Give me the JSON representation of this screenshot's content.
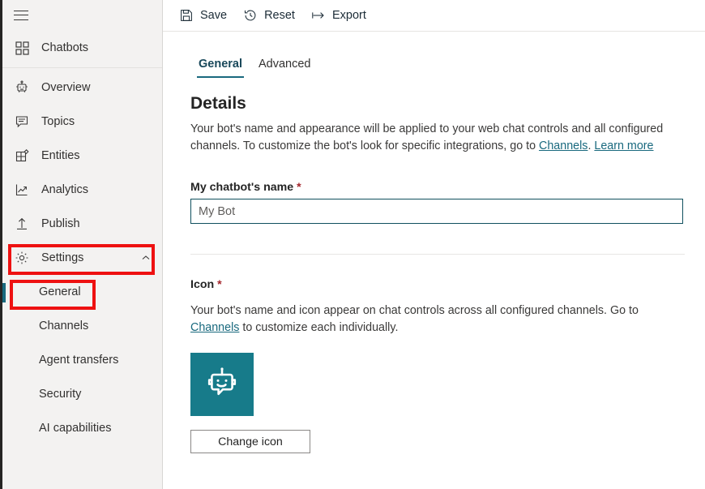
{
  "sidebar": {
    "hamburger_name": "hamburger-menu",
    "top_items": [
      {
        "label": "Chatbots",
        "icon": "grid-icon"
      }
    ],
    "items": [
      {
        "label": "Overview",
        "icon": "robot-icon"
      },
      {
        "label": "Topics",
        "icon": "chat-bubble-icon"
      },
      {
        "label": "Entities",
        "icon": "entities-grid-icon"
      },
      {
        "label": "Analytics",
        "icon": "chart-line-icon"
      },
      {
        "label": "Publish",
        "icon": "upload-arrow-icon"
      }
    ],
    "settings": {
      "label": "Settings",
      "icon": "gear-icon",
      "chevron": "chevron-up-icon",
      "expanded": true
    },
    "sub_items": [
      {
        "label": "General",
        "selected": true
      },
      {
        "label": "Channels",
        "selected": false
      },
      {
        "label": "Agent transfers",
        "selected": false
      },
      {
        "label": "Security",
        "selected": false
      },
      {
        "label": "AI capabilities",
        "selected": false
      }
    ]
  },
  "toolbar": {
    "save": {
      "label": "Save",
      "icon": "save-floppy-icon"
    },
    "reset": {
      "label": "Reset",
      "icon": "clock-undo-icon"
    },
    "export": {
      "label": "Export",
      "icon": "export-arrow-icon"
    }
  },
  "tabs": [
    {
      "label": "General",
      "active": true
    },
    {
      "label": "Advanced",
      "active": false
    }
  ],
  "details": {
    "title": "Details",
    "desc_part1": "Your bot's name and appearance will be applied to your web chat controls and all configured channels. To customize the bot's look for specific integrations, go to ",
    "desc_link1": "Channels",
    "desc_mid": ". ",
    "desc_link2": "Learn more"
  },
  "name_field": {
    "label": "My chatbot's name",
    "required_mark": "*",
    "value": "My Bot"
  },
  "icon_section": {
    "label": "Icon",
    "required_mark": "*",
    "desc_part1": "Your bot's name and icon appear on chat controls across all configured channels. Go to ",
    "desc_link": "Channels",
    "desc_part2": " to customize each individually.",
    "tile_icon": "bot-avatar-icon",
    "change_button": "Change icon"
  },
  "colors": {
    "accent_teal": "#19697e",
    "tile_teal": "#177b8a",
    "input_border": "#10505e",
    "annotation_red": "#ee1111",
    "sidebar_bg": "#f3f2f1"
  }
}
